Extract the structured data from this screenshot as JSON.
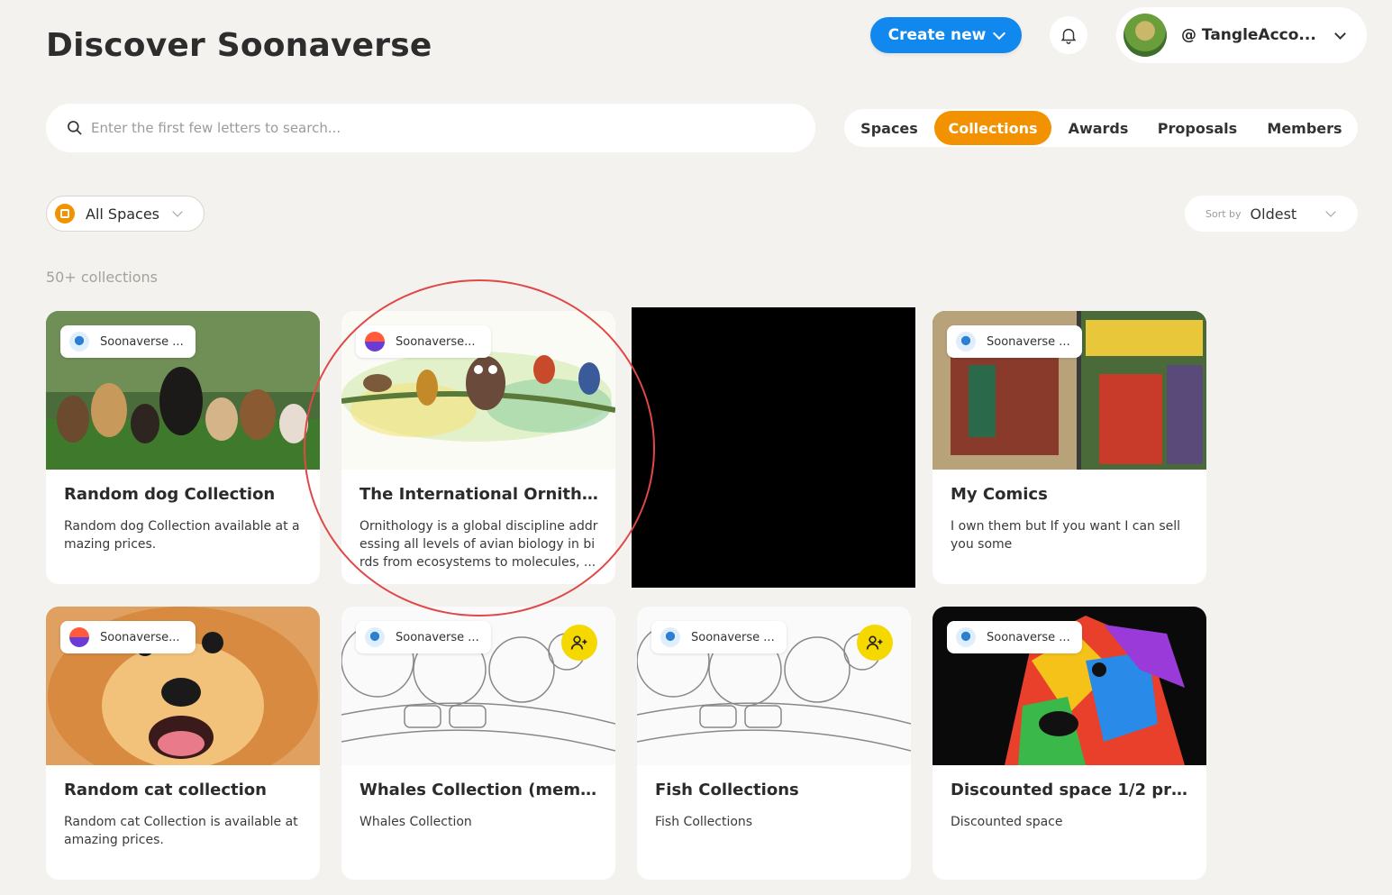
{
  "page": {
    "title": "Discover Soonaverse"
  },
  "header": {
    "create_label": "Create new",
    "account_name": "@ TangleAcco..."
  },
  "search": {
    "placeholder": "Enter the first few letters to search..."
  },
  "tabs": [
    {
      "label": "Spaces",
      "active": false
    },
    {
      "label": "Collections",
      "active": true
    },
    {
      "label": "Awards",
      "active": false
    },
    {
      "label": "Proposals",
      "active": false
    },
    {
      "label": "Members",
      "active": false
    }
  ],
  "filter": {
    "label": "All Spaces"
  },
  "sort": {
    "by_label": "Sort by",
    "value": "Oldest"
  },
  "count_text": "50+ collections",
  "colors": {
    "accent": "#f39200",
    "primary": "#1088ee",
    "background": "#f4f2ee",
    "badge": "#f5d800"
  },
  "cards": [
    {
      "space": "Soonaverse ...",
      "title": "Random dog Collection",
      "description": "Random dog Collection available at amazing prices.",
      "image": "dogs-group-photo",
      "logo": "soonaverse-blue-logo",
      "members_only": false
    },
    {
      "space": "Soonaverse...",
      "title": "The International Ornitholo...",
      "description": "Ornithology is a global discipline addressing all levels of avian biology in birds from ecosystems to molecules, ...",
      "image": "birds-watercolor",
      "logo": "soonaverse-purple-logo",
      "members_only": false
    },
    {
      "space": "Soonaverse ...",
      "title": "My Comics",
      "description": "I own them but If you want I can sell you some",
      "image": "comic-books",
      "logo": "soonaverse-blue-logo",
      "members_only": false
    },
    {
      "space": "Soonaverse...",
      "title": "Random cat collection",
      "description": "Random cat Collection is available at amazing prices.",
      "image": "pomeranian-dog",
      "logo": "soonaverse-purple-logo",
      "members_only": false
    },
    {
      "space": "Soonaverse ...",
      "title": "Whales Collection (memb...",
      "description": "Whales Collection",
      "image": "soon-sketch",
      "logo": "soonaverse-blue-logo",
      "members_only": true
    },
    {
      "space": "Soonaverse ...",
      "title": "Fish Collections",
      "description": "Fish Collections",
      "image": "soon-sketch",
      "logo": "soonaverse-blue-logo",
      "members_only": true
    },
    {
      "space": "Soonaverse ...",
      "title": "Discounted space 1/2 price",
      "description": "Discounted space",
      "image": "colorful-dog-art",
      "logo": "soonaverse-blue-logo",
      "members_only": false
    }
  ]
}
